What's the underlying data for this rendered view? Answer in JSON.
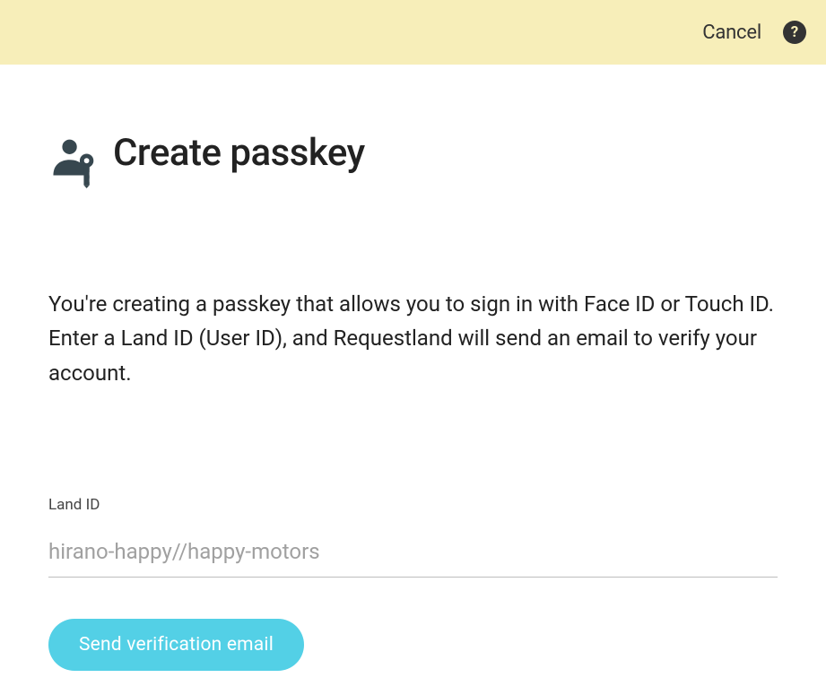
{
  "header": {
    "cancel_label": "Cancel",
    "help_glyph": "?"
  },
  "main": {
    "title": "Create passkey",
    "description": "You're creating a passkey that allows you to sign in with Face ID or Touch ID. Enter a Land ID (User ID), and Requestland will send an email to verify your account.",
    "field": {
      "label": "Land ID",
      "placeholder": "hirano-happy//happy-motors",
      "value": ""
    },
    "submit_label": "Send verification email"
  },
  "colors": {
    "header_bg": "#f7eeb9",
    "icon_fg": "#37474f",
    "accent": "#53d0e6"
  }
}
